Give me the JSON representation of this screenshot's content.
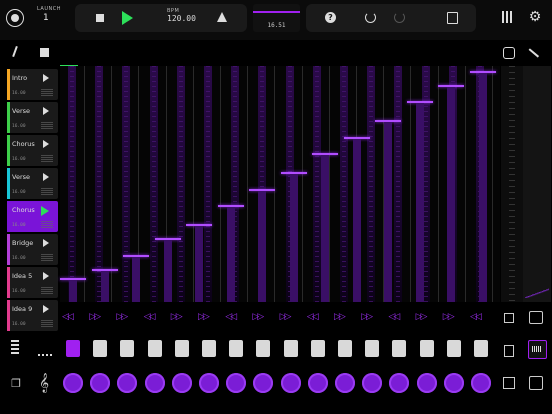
{
  "launch": {
    "label": "LAUNCH",
    "value": "1"
  },
  "transport": {
    "bpm_label": "BPM",
    "bpm_value": "120.00"
  },
  "position": "16.51",
  "scenes": [
    {
      "name": "Intro",
      "length": "16.00",
      "color": "#f5a623",
      "active": false
    },
    {
      "name": "Verse",
      "length": "16.00",
      "color": "#3ecf4a",
      "active": false
    },
    {
      "name": "Chorus",
      "length": "16.00",
      "color": "#3ecf4a",
      "active": false
    },
    {
      "name": "Verse",
      "length": "16.00",
      "color": "#18c6d8",
      "active": false
    },
    {
      "name": "Chorus",
      "length": "16.00",
      "color": "#7a14d8",
      "active": true
    },
    {
      "name": "Bridge",
      "length": "16.00",
      "color": "#b33fd9",
      "active": false
    },
    {
      "name": "Idea 5",
      "length": "16.00",
      "color": "#e33b8e",
      "active": false
    },
    {
      "name": "Idea 9",
      "length": "16.00",
      "color": "#e33b8e",
      "active": false
    }
  ],
  "icons": {
    "record": "record-icon",
    "stop": "stop-icon",
    "play": "play-icon",
    "warning": "warning-icon",
    "help": "help-icon",
    "undo": "undo-icon",
    "redo": "redo-icon",
    "save": "save-icon",
    "library": "library-icon",
    "settings": "gear-icon",
    "pencil": "pencil-icon",
    "select": "select-icon"
  },
  "steps": {
    "levels": [
      0.05,
      0.09,
      0.15,
      0.22,
      0.28,
      0.36,
      0.43,
      0.5,
      0.58,
      0.65,
      0.72,
      0.8,
      0.87,
      0.93
    ],
    "pads_active": [
      true,
      false,
      false,
      false,
      false,
      false,
      false,
      false,
      false,
      false,
      false,
      false,
      false,
      false,
      false,
      false
    ]
  },
  "colors": {
    "accent": "#a020f0",
    "play": "#2de05a"
  }
}
